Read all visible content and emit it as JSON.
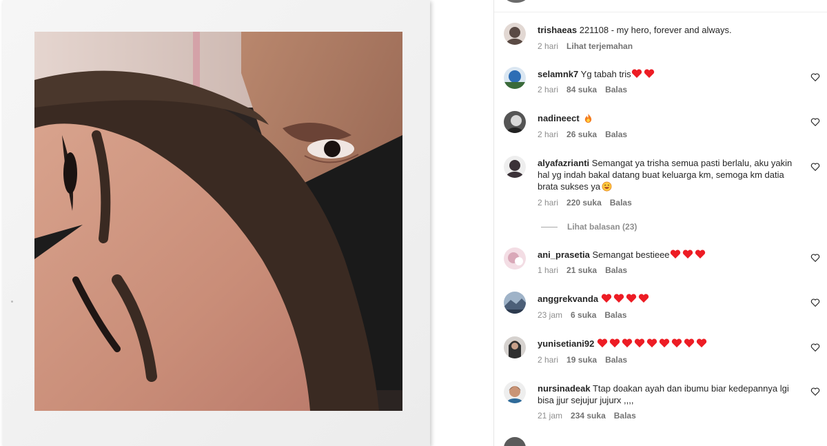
{
  "media": {
    "icon": "photo"
  },
  "comments": [
    {
      "username": "trishaeas",
      "text": "221108 - my hero, forever and always.",
      "time": "2 hari",
      "action": "Lihat terjemahan",
      "avatar_color": "#5a4a44"
    },
    {
      "username": "selamnk7",
      "text": "Yg tabah tris",
      "hearts": 2,
      "time": "2 hari",
      "likes": "84 suka",
      "reply": "Balas",
      "avatar_color": "#2d6db5"
    },
    {
      "username": "nadineect",
      "text": "",
      "emoji": "fire",
      "time": "2 hari",
      "likes": "26 suka",
      "reply": "Balas",
      "avatar_color": "#555555"
    },
    {
      "username": "alyafazrianti",
      "text": "Semangat ya trisha semua pasti berlalu, aku yakin hal yg indah bakal datang buat keluarga km, semoga km datia brata sukses ya",
      "emoji": "smile",
      "time": "2 hari",
      "likes": "220 suka",
      "reply": "Balas",
      "avatar_color": "#3b3238",
      "view_replies": "Lihat balasan (23)"
    },
    {
      "username": "ani_prasetia",
      "text": "Semangat bestieee",
      "hearts": 3,
      "time": "1 hari",
      "likes": "21 suka",
      "reply": "Balas",
      "avatar_color": "#e8c4cf"
    },
    {
      "username": "anggrekvanda",
      "text": "",
      "hearts": 4,
      "time": "23 jam",
      "likes": "6 suka",
      "reply": "Balas",
      "avatar_color": "#4c5f78"
    },
    {
      "username": "yunisetiani92",
      "text": "",
      "hearts": 9,
      "time": "2 hari",
      "likes": "19 suka",
      "reply": "Balas",
      "avatar_color": "#2f2f2f"
    },
    {
      "username": "nursinadeak",
      "text": "Ttap doakan ayah dan ibumu biar kedepannya lgi bisa jjur sejujur jujurx ,,,,",
      "time": "21 jam",
      "likes": "234 suka",
      "reply": "Balas",
      "avatar_color": "#3a2a24"
    }
  ],
  "colors": {
    "heart": "#ed1c24",
    "muted": "#8e8e8e",
    "text": "#262626"
  }
}
